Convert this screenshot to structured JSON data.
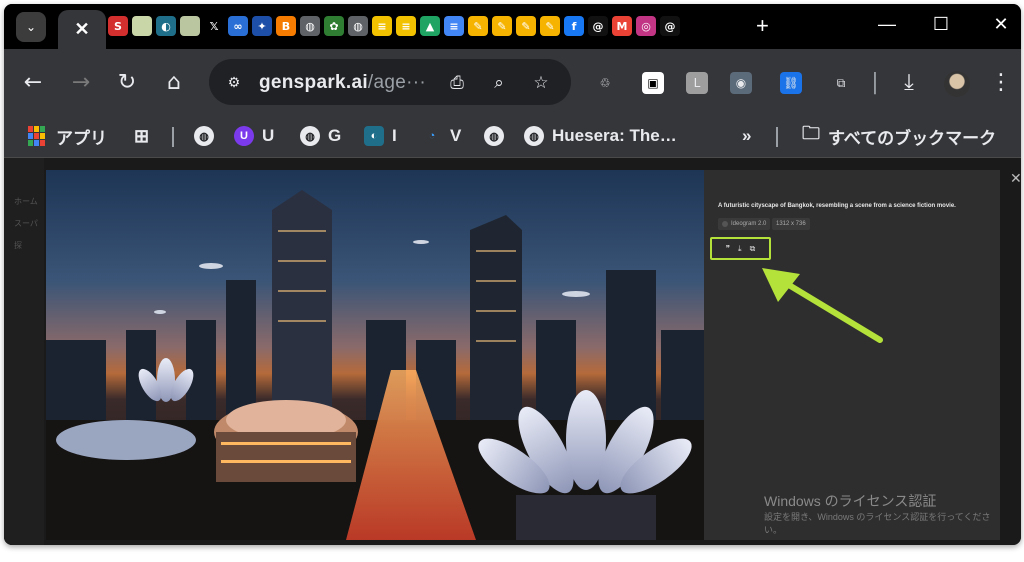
{
  "tabs": {
    "active_close": "✕",
    "favicons": [
      {
        "name": "s-favicon",
        "glyph": "S",
        "bg": "#d32f2f"
      },
      {
        "name": "image-favicon",
        "glyph": "",
        "bg": "#c9d7a8"
      },
      {
        "name": "o-favicon",
        "glyph": "◐",
        "bg": "#1f6f8b"
      },
      {
        "name": "image-favicon-2",
        "glyph": "",
        "bg": "#b9c6a0"
      },
      {
        "name": "x-favicon",
        "glyph": "𝕏",
        "bg": "#000000"
      },
      {
        "name": "chain-favicon",
        "glyph": "∞",
        "bg": "#2a6fd6"
      },
      {
        "name": "sparkle-favicon",
        "glyph": "✦",
        "bg": "#1e4fa8"
      },
      {
        "name": "blogger-favicon",
        "glyph": "B",
        "bg": "#f57c00"
      },
      {
        "name": "globe-favicon",
        "glyph": "◍",
        "bg": "#5f6368"
      },
      {
        "name": "leaf-favicon",
        "glyph": "✿",
        "bg": "#2e7d32"
      },
      {
        "name": "globe-favicon-2",
        "glyph": "◍",
        "bg": "#5f6368"
      },
      {
        "name": "sheet-favicon",
        "glyph": "≡",
        "bg": "#f2c200"
      },
      {
        "name": "sheet-favicon-2",
        "glyph": "≡",
        "bg": "#f2c200"
      },
      {
        "name": "drive-favicon",
        "glyph": "▲",
        "bg": "#1fa463"
      },
      {
        "name": "docs-favicon",
        "glyph": "≡",
        "bg": "#4285f4"
      },
      {
        "name": "keep-favicon",
        "glyph": "✎",
        "bg": "#f6b400"
      },
      {
        "name": "keep-favicon-2",
        "glyph": "✎",
        "bg": "#f6b400"
      },
      {
        "name": "keep-favicon-3",
        "glyph": "✎",
        "bg": "#f6b400"
      },
      {
        "name": "keep-favicon-4",
        "glyph": "✎",
        "bg": "#f6b400"
      },
      {
        "name": "facebook-favicon",
        "glyph": "f",
        "bg": "#1877f2"
      },
      {
        "name": "threads-favicon",
        "glyph": "@",
        "bg": "#111111"
      },
      {
        "name": "gmail-favicon",
        "glyph": "M",
        "bg": "#ea4335"
      },
      {
        "name": "instagram-favicon",
        "glyph": "◎",
        "bg": "#c13584"
      },
      {
        "name": "threads-favicon-2",
        "glyph": "@",
        "bg": "#111111"
      }
    ],
    "new_tab": "+"
  },
  "window_controls": {
    "minimize": "—",
    "maximize": "☐",
    "close": "✕"
  },
  "toolbar": {
    "url_host": "genspark.ai",
    "url_path": "/age···",
    "ext_icons": [
      {
        "name": "recycle-extension-icon",
        "glyph": "♲",
        "bg": "transparent"
      },
      {
        "name": "square-extension-icon",
        "glyph": "▣",
        "bg": "#ffffff"
      },
      {
        "name": "line-extension-icon",
        "glyph": "L",
        "bg": "#9e9e9e"
      },
      {
        "name": "owl-extension-icon",
        "glyph": "◉",
        "bg": "#5c6b7a"
      },
      {
        "name": "link-extension-icon",
        "glyph": "⛓",
        "bg": "#1a73e8"
      },
      {
        "name": "puzzle-extension-icon",
        "glyph": "⧉",
        "bg": "transparent"
      }
    ]
  },
  "bookmarks": [
    {
      "name": "bookmark-apps",
      "icon": "▦",
      "label": "アプリ"
    },
    {
      "name": "bookmark-grid",
      "icon": "▦",
      "label": ""
    },
    {
      "name": "bookmark-globe",
      "icon": "◍",
      "label": ""
    },
    {
      "name": "bookmark-u",
      "icon": "U",
      "label": "U"
    },
    {
      "name": "bookmark-g",
      "icon": "◍",
      "label": "G"
    },
    {
      "name": "bookmark-i",
      "icon": "◐",
      "label": "I"
    },
    {
      "name": "bookmark-v",
      "icon": "◔",
      "label": "V"
    },
    {
      "name": "bookmark-globe-2",
      "icon": "◍",
      "label": ""
    },
    {
      "name": "bookmark-huesera",
      "icon": "◍",
      "label": "Huesera: The…"
    }
  ],
  "bookmarks_overflow": "»",
  "all_bookmarks": "すべてのブックマーク",
  "modal": {
    "prompt": "A futuristic cityscape of Bangkok, resembling a scene from a science fiction movie.",
    "model": "Ideogram 2.0",
    "size": "1312 x 736",
    "actions": [
      "❞",
      "⤓",
      "⧉"
    ]
  },
  "watermark": {
    "title": "Windows のライセンス認証",
    "subtitle": "設定を開き、Windows のライセンス認証を行ってください。"
  },
  "bg_sidebar": [
    "ホーム",
    "スーパ",
    "探"
  ],
  "accent": "#b4e23a"
}
